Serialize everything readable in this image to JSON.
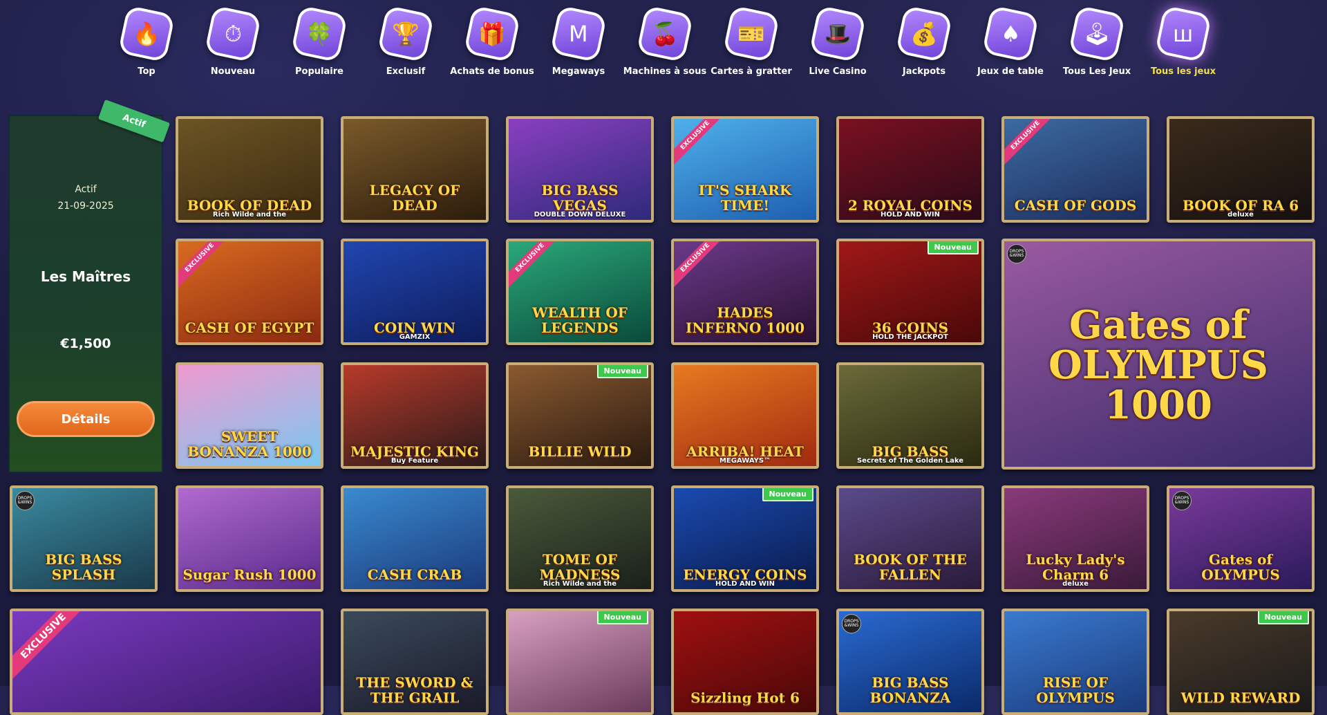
{
  "categories": [
    {
      "label": "Top",
      "icon": "🔥",
      "icon_name": "fire-icon",
      "active": false
    },
    {
      "label": "Nouveau",
      "icon": "⏱",
      "icon_name": "stopwatch-icon",
      "active": false
    },
    {
      "label": "Populaire",
      "icon": "🍀",
      "icon_name": "clover-icon",
      "active": false
    },
    {
      "label": "Exclusif",
      "icon": "🏆",
      "icon_name": "trophy-icon",
      "active": false
    },
    {
      "label": "Achats de bonus",
      "icon": "🎁",
      "icon_name": "gift-icon",
      "active": false
    },
    {
      "label": "Megaways",
      "icon": "M",
      "icon_name": "megaways-icon",
      "active": false
    },
    {
      "label": "Machines à sous",
      "icon": "🍒",
      "icon_name": "cherry-icon",
      "active": false
    },
    {
      "label": "Cartes à gratter",
      "icon": "🎫",
      "icon_name": "scratch-card-icon",
      "active": false
    },
    {
      "label": "Live Casino",
      "icon": "🎩",
      "icon_name": "dealer-icon",
      "active": false
    },
    {
      "label": "Jackpots",
      "icon": "💰",
      "icon_name": "money-bag-icon",
      "active": false
    },
    {
      "label": "Jeux de table",
      "icon": "♠",
      "icon_name": "spade-card-icon",
      "active": false
    },
    {
      "label": "Tous Les Jeux",
      "icon": "🕹",
      "icon_name": "joystick-icon",
      "active": false
    },
    {
      "label": "Tous les jeux",
      "icon": "ш",
      "icon_name": "provider-logo-icon",
      "active": true
    }
  ],
  "tournament": {
    "ribbon": "Actif",
    "status": "Actif",
    "date": "21-09-2025",
    "name": "Les Maîtres",
    "prize": "€1,500",
    "button": "Détails"
  },
  "games": [
    {
      "title": "BOOK OF DEAD",
      "sub": "Rich Wilde and the",
      "colors": [
        "#6b5424",
        "#3b2a10"
      ]
    },
    {
      "title": "LEGACY OF DEAD",
      "sub": "",
      "colors": [
        "#7a5a2a",
        "#2c1c0c"
      ]
    },
    {
      "title": "BIG BASS VEGAS",
      "sub": "DOUBLE DOWN DELUXE",
      "colors": [
        "#8a3fc0",
        "#2d2a7a"
      ]
    },
    {
      "title": "IT'S SHARK TIME!",
      "sub": "",
      "colors": [
        "#4fb0ea",
        "#1d5fb0"
      ],
      "exclusive": "EXCLUSIVE"
    },
    {
      "title": "2 ROYAL COINS",
      "sub": "HOLD AND WIN",
      "colors": [
        "#7a1020",
        "#2a0a18"
      ]
    },
    {
      "title": "CASH OF GODS",
      "sub": "",
      "colors": [
        "#3c6aa0",
        "#1c2c5c"
      ],
      "exclusive": "EXCLUSIVE"
    },
    {
      "title": "BOOK OF RA 6",
      "sub": "deluxe",
      "colors": [
        "#3a2a1a",
        "#151010"
      ]
    },
    {
      "title": "CASH OF EGYPT",
      "sub": "",
      "colors": [
        "#d86a20",
        "#8c2a10"
      ],
      "exclusive": "EXCLUSIVE"
    },
    {
      "title": "COIN WIN",
      "sub": "GAMZIX",
      "colors": [
        "#2046b0",
        "#0e1c5a"
      ]
    },
    {
      "title": "WEALTH OF LEGENDS",
      "sub": "",
      "colors": [
        "#2aa87a",
        "#0a4a3a"
      ],
      "exclusive": "EXCLUSIVE"
    },
    {
      "title": "HADES INFERNO 1000",
      "sub": "",
      "colors": [
        "#6a3a8a",
        "#2a1030"
      ],
      "exclusive": "EXCLUSIVE"
    },
    {
      "title": "36 COINS",
      "sub": "HOLD THE JACKPOT",
      "colors": [
        "#a01818",
        "#4a0808"
      ],
      "badge": "Nouveau"
    },
    {
      "title": "Gates of OLYMPUS 1000",
      "sub": "",
      "colors": [
        "#9a5aa0",
        "#3a2a6a"
      ],
      "big": true,
      "drops": "DROPS &WINS"
    },
    {
      "title": "SWEET BONANZA 1000",
      "sub": "",
      "colors": [
        "#f09ad0",
        "#7ac8f0"
      ]
    },
    {
      "title": "MAJESTIC KING",
      "sub": "Buy Feature",
      "colors": [
        "#b83a2a",
        "#2a1a1a"
      ]
    },
    {
      "title": "BILLIE WILD",
      "sub": "",
      "colors": [
        "#8a5a30",
        "#2a1a10"
      ],
      "badge": "Nouveau"
    },
    {
      "title": "ARRIBA! HEAT",
      "sub": "MEGAWAYS™",
      "colors": [
        "#e87a20",
        "#a02a10"
      ]
    },
    {
      "title": "BIG BASS",
      "sub": "Secrets of The Golden Lake",
      "colors": [
        "#6a6a3a",
        "#2a2a10"
      ]
    },
    {
      "title": "BIG BASS SPLASH",
      "sub": "",
      "colors": [
        "#3a8aa0",
        "#1a3a4a"
      ],
      "drops": "DROPS &WINS"
    },
    {
      "title": "Sugar Rush 1000",
      "sub": "",
      "colors": [
        "#b06ad0",
        "#5a2a8a"
      ]
    },
    {
      "title": "CASH CRAB",
      "sub": "",
      "colors": [
        "#3a8ad0",
        "#1a3a7a"
      ]
    },
    {
      "title": "TOME OF MADNESS",
      "sub": "Rich Wilde and the",
      "colors": [
        "#4a5a3a",
        "#1a201a"
      ]
    },
    {
      "title": "ENERGY COINS",
      "sub": "HOLD AND WIN",
      "colors": [
        "#1a4ab0",
        "#0a1a4a"
      ],
      "badge": "Nouveau"
    },
    {
      "title": "BOOK OF THE FALLEN",
      "sub": "",
      "colors": [
        "#5a4a8a",
        "#2a1a3a"
      ]
    },
    {
      "title": "Lucky Lady's Charm 6",
      "sub": "deluxe",
      "colors": [
        "#8a3a7a",
        "#3a1a3a"
      ]
    },
    {
      "title": "Gates of OLYMPUS",
      "sub": "",
      "colors": [
        "#7a3a9a",
        "#2a1a5a"
      ],
      "drops": "DROPS &WINS"
    },
    {
      "title": "",
      "sub": "",
      "colors": [
        "#7a3ac0",
        "#3a1a6a"
      ],
      "wide": true,
      "exclusive": "EXCLUSIVE"
    },
    {
      "title": "THE SWORD & THE GRAIL",
      "sub": "",
      "colors": [
        "#3a4a5a",
        "#1a1a2a"
      ]
    },
    {
      "title": "",
      "sub": "",
      "colors": [
        "#d8a0c0",
        "#6a3a5a"
      ],
      "badge": "Nouveau"
    },
    {
      "title": "Sizzling Hot 6",
      "sub": "",
      "colors": [
        "#a01010",
        "#4a0808"
      ]
    },
    {
      "title": "BIG BASS BONANZA",
      "sub": "",
      "colors": [
        "#2a6ad0",
        "#0a2a6a"
      ],
      "drops": "DROPS &WINS"
    },
    {
      "title": "RISE OF OLYMPUS",
      "sub": "",
      "colors": [
        "#3a7ad0",
        "#1a3a7a"
      ]
    },
    {
      "title": "WILD REWARD",
      "sub": "",
      "colors": [
        "#4a3a2a",
        "#1a1a1a"
      ],
      "badge": "Nouveau"
    }
  ]
}
